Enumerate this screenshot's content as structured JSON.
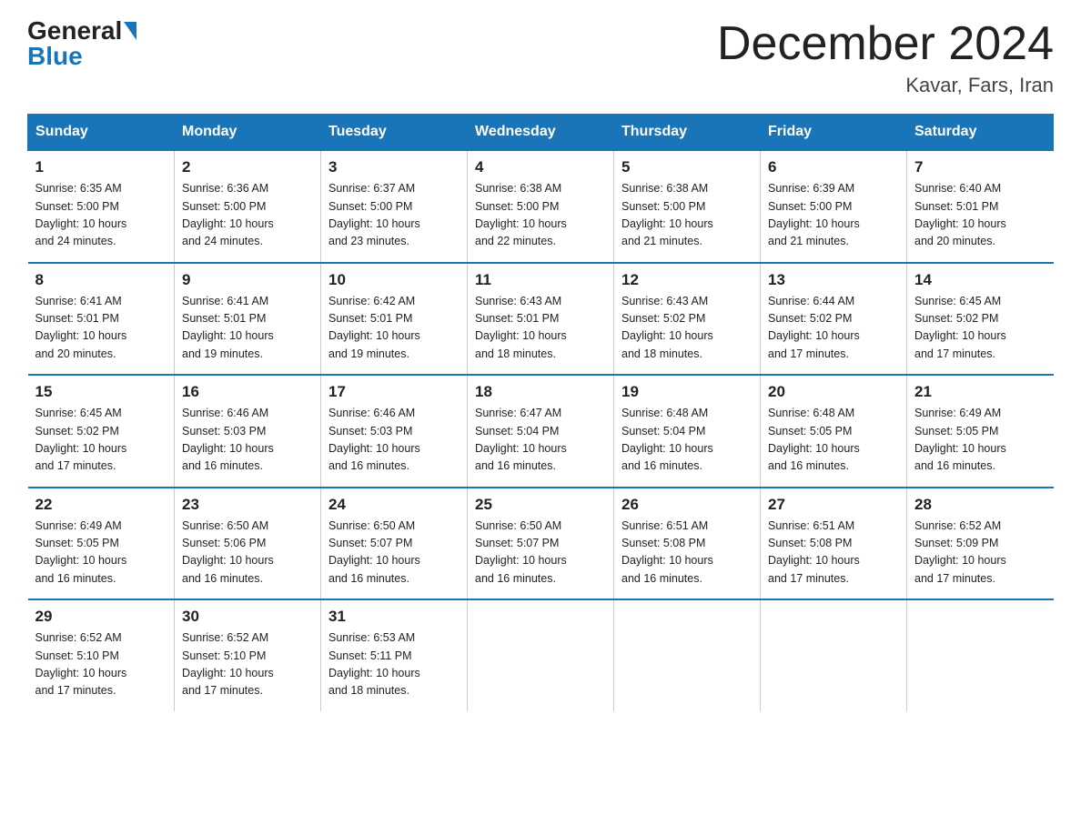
{
  "header": {
    "logo_general": "General",
    "logo_blue": "Blue",
    "title": "December 2024",
    "subtitle": "Kavar, Fars, Iran"
  },
  "days_of_week": [
    "Sunday",
    "Monday",
    "Tuesday",
    "Wednesday",
    "Thursday",
    "Friday",
    "Saturday"
  ],
  "weeks": [
    [
      {
        "num": "1",
        "sunrise": "6:35 AM",
        "sunset": "5:00 PM",
        "daylight": "10 hours and 24 minutes."
      },
      {
        "num": "2",
        "sunrise": "6:36 AM",
        "sunset": "5:00 PM",
        "daylight": "10 hours and 24 minutes."
      },
      {
        "num": "3",
        "sunrise": "6:37 AM",
        "sunset": "5:00 PM",
        "daylight": "10 hours and 23 minutes."
      },
      {
        "num": "4",
        "sunrise": "6:38 AM",
        "sunset": "5:00 PM",
        "daylight": "10 hours and 22 minutes."
      },
      {
        "num": "5",
        "sunrise": "6:38 AM",
        "sunset": "5:00 PM",
        "daylight": "10 hours and 21 minutes."
      },
      {
        "num": "6",
        "sunrise": "6:39 AM",
        "sunset": "5:00 PM",
        "daylight": "10 hours and 21 minutes."
      },
      {
        "num": "7",
        "sunrise": "6:40 AM",
        "sunset": "5:01 PM",
        "daylight": "10 hours and 20 minutes."
      }
    ],
    [
      {
        "num": "8",
        "sunrise": "6:41 AM",
        "sunset": "5:01 PM",
        "daylight": "10 hours and 20 minutes."
      },
      {
        "num": "9",
        "sunrise": "6:41 AM",
        "sunset": "5:01 PM",
        "daylight": "10 hours and 19 minutes."
      },
      {
        "num": "10",
        "sunrise": "6:42 AM",
        "sunset": "5:01 PM",
        "daylight": "10 hours and 19 minutes."
      },
      {
        "num": "11",
        "sunrise": "6:43 AM",
        "sunset": "5:01 PM",
        "daylight": "10 hours and 18 minutes."
      },
      {
        "num": "12",
        "sunrise": "6:43 AM",
        "sunset": "5:02 PM",
        "daylight": "10 hours and 18 minutes."
      },
      {
        "num": "13",
        "sunrise": "6:44 AM",
        "sunset": "5:02 PM",
        "daylight": "10 hours and 17 minutes."
      },
      {
        "num": "14",
        "sunrise": "6:45 AM",
        "sunset": "5:02 PM",
        "daylight": "10 hours and 17 minutes."
      }
    ],
    [
      {
        "num": "15",
        "sunrise": "6:45 AM",
        "sunset": "5:02 PM",
        "daylight": "10 hours and 17 minutes."
      },
      {
        "num": "16",
        "sunrise": "6:46 AM",
        "sunset": "5:03 PM",
        "daylight": "10 hours and 16 minutes."
      },
      {
        "num": "17",
        "sunrise": "6:46 AM",
        "sunset": "5:03 PM",
        "daylight": "10 hours and 16 minutes."
      },
      {
        "num": "18",
        "sunrise": "6:47 AM",
        "sunset": "5:04 PM",
        "daylight": "10 hours and 16 minutes."
      },
      {
        "num": "19",
        "sunrise": "6:48 AM",
        "sunset": "5:04 PM",
        "daylight": "10 hours and 16 minutes."
      },
      {
        "num": "20",
        "sunrise": "6:48 AM",
        "sunset": "5:05 PM",
        "daylight": "10 hours and 16 minutes."
      },
      {
        "num": "21",
        "sunrise": "6:49 AM",
        "sunset": "5:05 PM",
        "daylight": "10 hours and 16 minutes."
      }
    ],
    [
      {
        "num": "22",
        "sunrise": "6:49 AM",
        "sunset": "5:05 PM",
        "daylight": "10 hours and 16 minutes."
      },
      {
        "num": "23",
        "sunrise": "6:50 AM",
        "sunset": "5:06 PM",
        "daylight": "10 hours and 16 minutes."
      },
      {
        "num": "24",
        "sunrise": "6:50 AM",
        "sunset": "5:07 PM",
        "daylight": "10 hours and 16 minutes."
      },
      {
        "num": "25",
        "sunrise": "6:50 AM",
        "sunset": "5:07 PM",
        "daylight": "10 hours and 16 minutes."
      },
      {
        "num": "26",
        "sunrise": "6:51 AM",
        "sunset": "5:08 PM",
        "daylight": "10 hours and 16 minutes."
      },
      {
        "num": "27",
        "sunrise": "6:51 AM",
        "sunset": "5:08 PM",
        "daylight": "10 hours and 17 minutes."
      },
      {
        "num": "28",
        "sunrise": "6:52 AM",
        "sunset": "5:09 PM",
        "daylight": "10 hours and 17 minutes."
      }
    ],
    [
      {
        "num": "29",
        "sunrise": "6:52 AM",
        "sunset": "5:10 PM",
        "daylight": "10 hours and 17 minutes."
      },
      {
        "num": "30",
        "sunrise": "6:52 AM",
        "sunset": "5:10 PM",
        "daylight": "10 hours and 17 minutes."
      },
      {
        "num": "31",
        "sunrise": "6:53 AM",
        "sunset": "5:11 PM",
        "daylight": "10 hours and 18 minutes."
      },
      {
        "num": "",
        "sunrise": "",
        "sunset": "",
        "daylight": ""
      },
      {
        "num": "",
        "sunrise": "",
        "sunset": "",
        "daylight": ""
      },
      {
        "num": "",
        "sunrise": "",
        "sunset": "",
        "daylight": ""
      },
      {
        "num": "",
        "sunrise": "",
        "sunset": "",
        "daylight": ""
      }
    ]
  ],
  "labels": {
    "sunrise_prefix": "Sunrise: ",
    "sunset_prefix": "Sunset: ",
    "daylight_prefix": "Daylight: "
  }
}
